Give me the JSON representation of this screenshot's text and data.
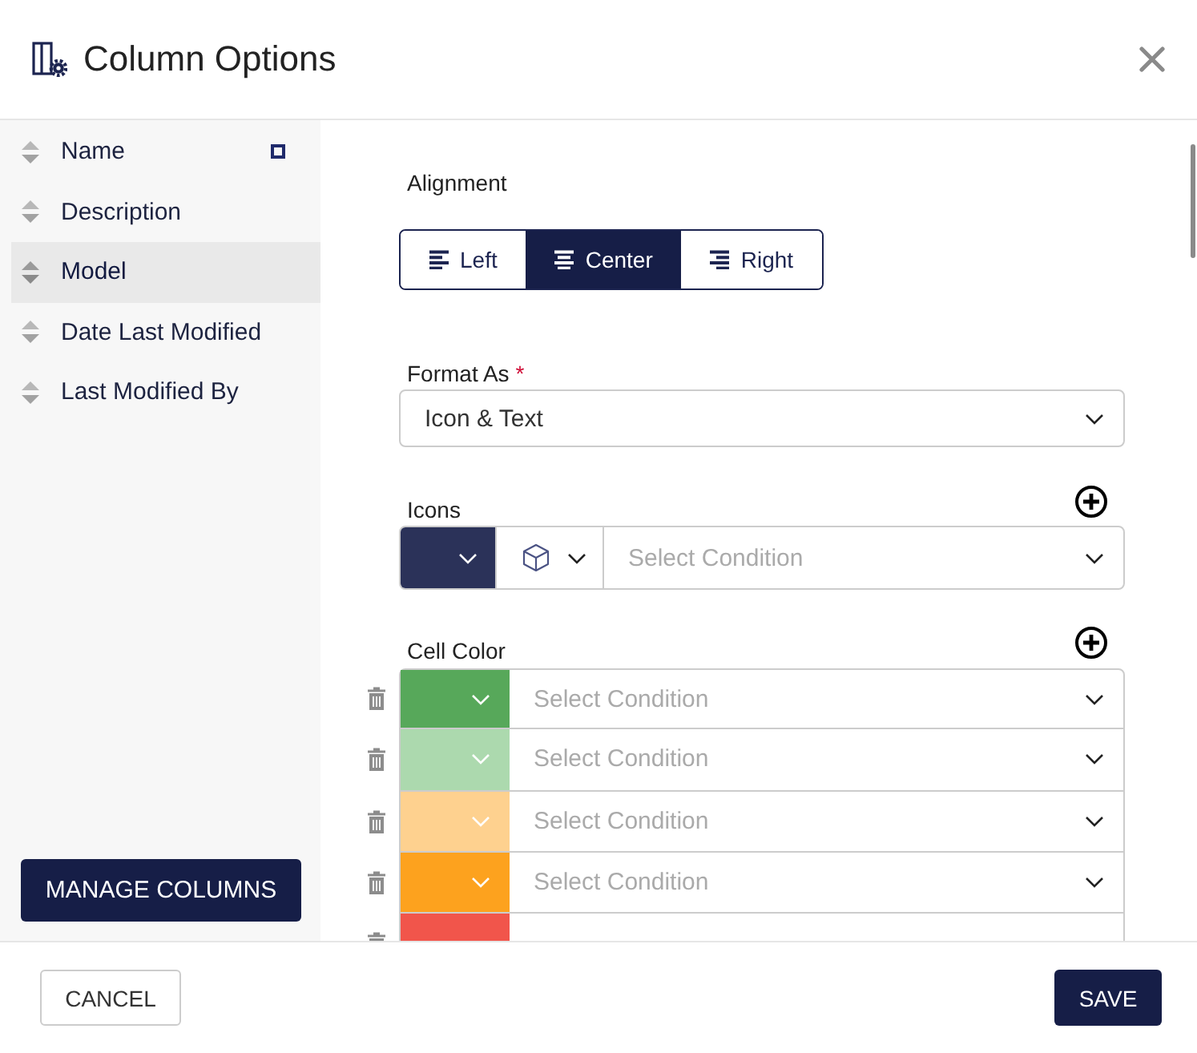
{
  "dialog": {
    "title": "Column Options"
  },
  "sidebar": {
    "items": [
      {
        "label": "Name",
        "selected": false,
        "marked": true
      },
      {
        "label": "Description",
        "selected": false,
        "marked": false
      },
      {
        "label": "Model",
        "selected": true,
        "marked": false
      },
      {
        "label": "Date Last Modified",
        "selected": false,
        "marked": false
      },
      {
        "label": "Last Modified By",
        "selected": false,
        "marked": false
      }
    ],
    "button": "MANAGE COLUMNS"
  },
  "alignment": {
    "label": "Alignment",
    "options": [
      {
        "kind": "left",
        "label": "Left",
        "selected": false
      },
      {
        "kind": "center",
        "label": "Center",
        "selected": true
      },
      {
        "kind": "right",
        "label": "Right",
        "selected": false
      }
    ]
  },
  "format": {
    "label": "Format As",
    "required_mark": "*",
    "value": "Icon & Text"
  },
  "icons": {
    "label": "Icons",
    "rows": [
      {
        "color": "#2b3259",
        "placeholder": "Select Condition"
      }
    ]
  },
  "cell_color": {
    "label": "Cell Color",
    "rows": [
      {
        "color": "#57a85a",
        "placeholder": "Select Condition"
      },
      {
        "color": "#acd9ae",
        "placeholder": "Select Condition"
      },
      {
        "color": "#fed18f",
        "placeholder": "Select Condition"
      },
      {
        "color": "#fda21e",
        "placeholder": "Select Condition"
      },
      {
        "color": "#f1554b"
      }
    ]
  },
  "footer": {
    "cancel": "CANCEL",
    "save": "SAVE"
  }
}
